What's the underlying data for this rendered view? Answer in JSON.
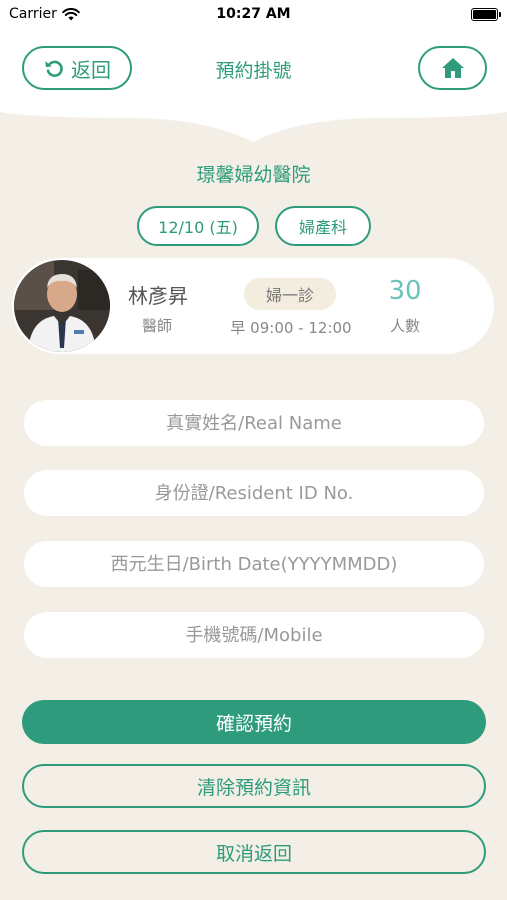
{
  "status_bar": {
    "carrier": "Carrier",
    "time": "10:27 AM"
  },
  "header": {
    "back_label": "返回",
    "title": "預約掛號"
  },
  "hospital": "璟馨婦幼醫院",
  "chips": {
    "date": "12/10 (五)",
    "department": "婦產科"
  },
  "doctor": {
    "name": "林彥昇",
    "title": "醫師",
    "clinic": "婦一診",
    "time": "早 09:00 - 12:00",
    "count": "30",
    "count_label": "人數"
  },
  "form": {
    "name_placeholder": "真實姓名/Real Name",
    "id_placeholder": "身份證/Resident ID No.",
    "birth_placeholder": "西元生日/Birth Date(YYYYMMDD)",
    "mobile_placeholder": "手機號碼/Mobile"
  },
  "actions": {
    "confirm": "確認預約",
    "clear": "清除預約資訊",
    "cancel": "取消返回"
  },
  "colors": {
    "accent": "#2e9c7c",
    "background": "#f3efe6",
    "count": "#6cc4b8"
  },
  "icons": {
    "back": "undo-icon",
    "home": "home-icon",
    "wifi": "wifi-icon",
    "battery": "battery-icon"
  }
}
